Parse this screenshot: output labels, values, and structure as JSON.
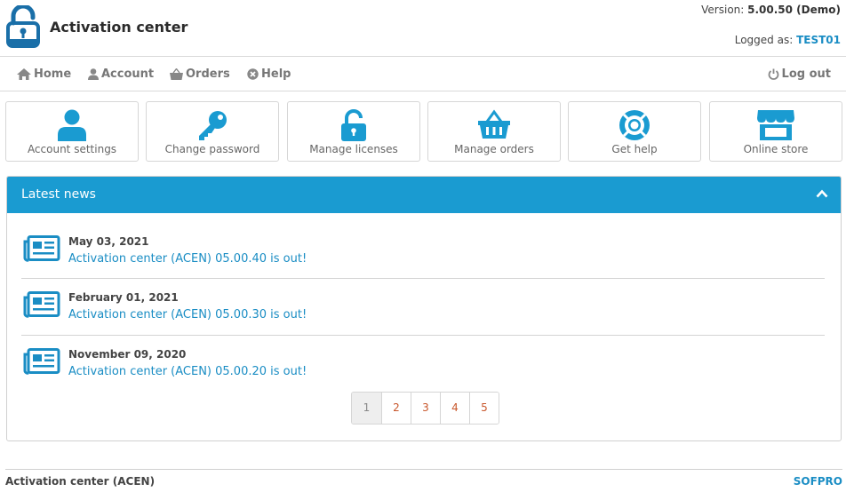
{
  "header": {
    "app_title": "Activation center",
    "version_label": "Version:",
    "version_value": "5.00.50 (Demo)",
    "logged_label": "Logged as:",
    "logged_user": "TEST01"
  },
  "nav": {
    "home": "Home",
    "account": "Account",
    "orders": "Orders",
    "help": "Help",
    "logout": "Log out"
  },
  "tiles": [
    {
      "label": "Account settings",
      "icon": "user-icon"
    },
    {
      "label": "Change password",
      "icon": "key-icon"
    },
    {
      "label": "Manage licenses",
      "icon": "unlock-icon"
    },
    {
      "label": "Manage orders",
      "icon": "basket-icon"
    },
    {
      "label": "Get help",
      "icon": "lifebuoy-icon"
    },
    {
      "label": "Online store",
      "icon": "store-icon"
    }
  ],
  "news": {
    "title": "Latest news",
    "items": [
      {
        "date": "May 03, 2021",
        "text": "Activation center (ACEN) 05.00.40 is out!"
      },
      {
        "date": "February 01, 2021",
        "text": "Activation center (ACEN) 05.00.30 is out!"
      },
      {
        "date": "November 09, 2020",
        "text": "Activation center (ACEN) 05.00.20 is out!"
      }
    ],
    "pages": [
      "1",
      "2",
      "3",
      "4",
      "5"
    ]
  },
  "footer": {
    "left": "Activation center (ACEN)",
    "right": "SOFPRO"
  },
  "colors": {
    "accent": "#1a9bd1",
    "link": "#1a8dc4",
    "pager_text": "#c8572c"
  }
}
